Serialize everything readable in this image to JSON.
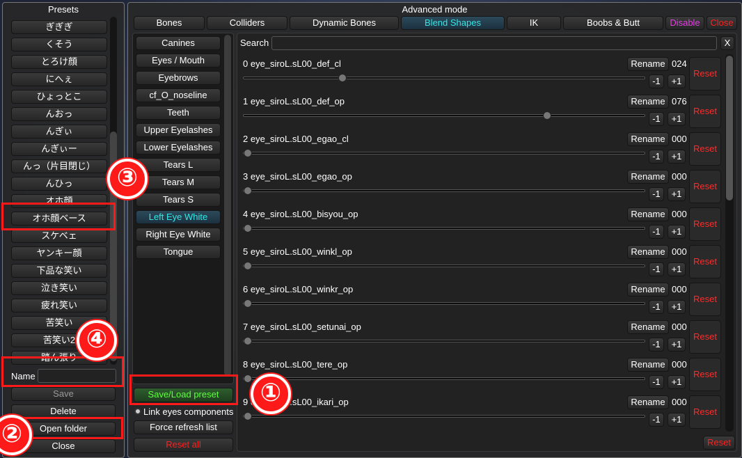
{
  "presets_panel": {
    "title": "Presets",
    "items": [
      "ぎぎぎ",
      "くそう",
      "とろけ顔",
      "にへぇ",
      "ひょっとこ",
      "んおっ",
      "んぎぃ",
      "んぎぃー",
      "んっ（片目閉じ）",
      "んひっ",
      "オホ顔",
      "オホ顔ベース",
      "スケベェ",
      "ヤンキー顔",
      "下品な笑い",
      "泣き笑い",
      "疲れ笑い",
      "苦笑い",
      "苦笑い2",
      "踏ん張り"
    ],
    "name_label": "Name",
    "name_value": "",
    "save_label": "Save",
    "delete_label": "Delete",
    "open_folder_label": "Open folder",
    "close_label": "Close"
  },
  "advanced": {
    "title": "Advanced mode",
    "tabs": [
      "Bones",
      "Colliders",
      "Dynamic Bones",
      "Blend Shapes",
      "IK",
      "Boobs & Butt"
    ],
    "active_tab": "Blend Shapes",
    "disable_label": "Disable",
    "close_label": "Close",
    "categories": [
      "Canines",
      "Eyes / Mouth",
      "Eyebrows",
      "cf_O_noseline",
      "Teeth",
      "Upper Eyelashes",
      "Lower Eyelashes",
      "Tears L",
      "Tears M",
      "Tears S",
      "Left Eye White",
      "Right Eye White",
      "Tongue"
    ],
    "active_category": "Left Eye White",
    "save_load_label": "Save/Load preset",
    "link_eyes_label": "Link eyes components",
    "force_refresh_label": "Force refresh list",
    "reset_all_label": "Reset all",
    "search_label": "Search",
    "search_value": "",
    "search_clear": "X",
    "rename_label": "Rename",
    "minus_label": "-1",
    "plus_label": "+1",
    "reset_label": "Reset",
    "bottom_reset_label": "Reset",
    "shapes": [
      {
        "name": "0 eye_siroL.sL00_def_cl",
        "value": "024",
        "level": 0.24
      },
      {
        "name": "1 eye_siroL.sL00_def_op",
        "value": "076",
        "level": 0.76
      },
      {
        "name": "2 eye_siroL.sL00_egao_cl",
        "value": "000",
        "level": 0
      },
      {
        "name": "3 eye_siroL.sL00_egao_op",
        "value": "000",
        "level": 0
      },
      {
        "name": "4 eye_siroL.sL00_bisyou_op",
        "value": "000",
        "level": 0
      },
      {
        "name": "5 eye_siroL.sL00_winkl_op",
        "value": "000",
        "level": 0
      },
      {
        "name": "6 eye_siroL.sL00_winkr_op",
        "value": "000",
        "level": 0
      },
      {
        "name": "7 eye_siroL.sL00_setunai_op",
        "value": "000",
        "level": 0
      },
      {
        "name": "8 eye_siroL.sL00_tere_op",
        "value": "000",
        "level": 0
      },
      {
        "name": "9 eye_siroL.sL00_ikari_op",
        "value": "000",
        "level": 0
      }
    ]
  },
  "annotations": [
    "③",
    "④",
    "①",
    "②"
  ],
  "colors": {
    "accent_cyan": "#35e6e6",
    "highlight_red": "#ff1a1a",
    "save_green": "#60ff40",
    "disable_magenta": "#e040e0"
  }
}
